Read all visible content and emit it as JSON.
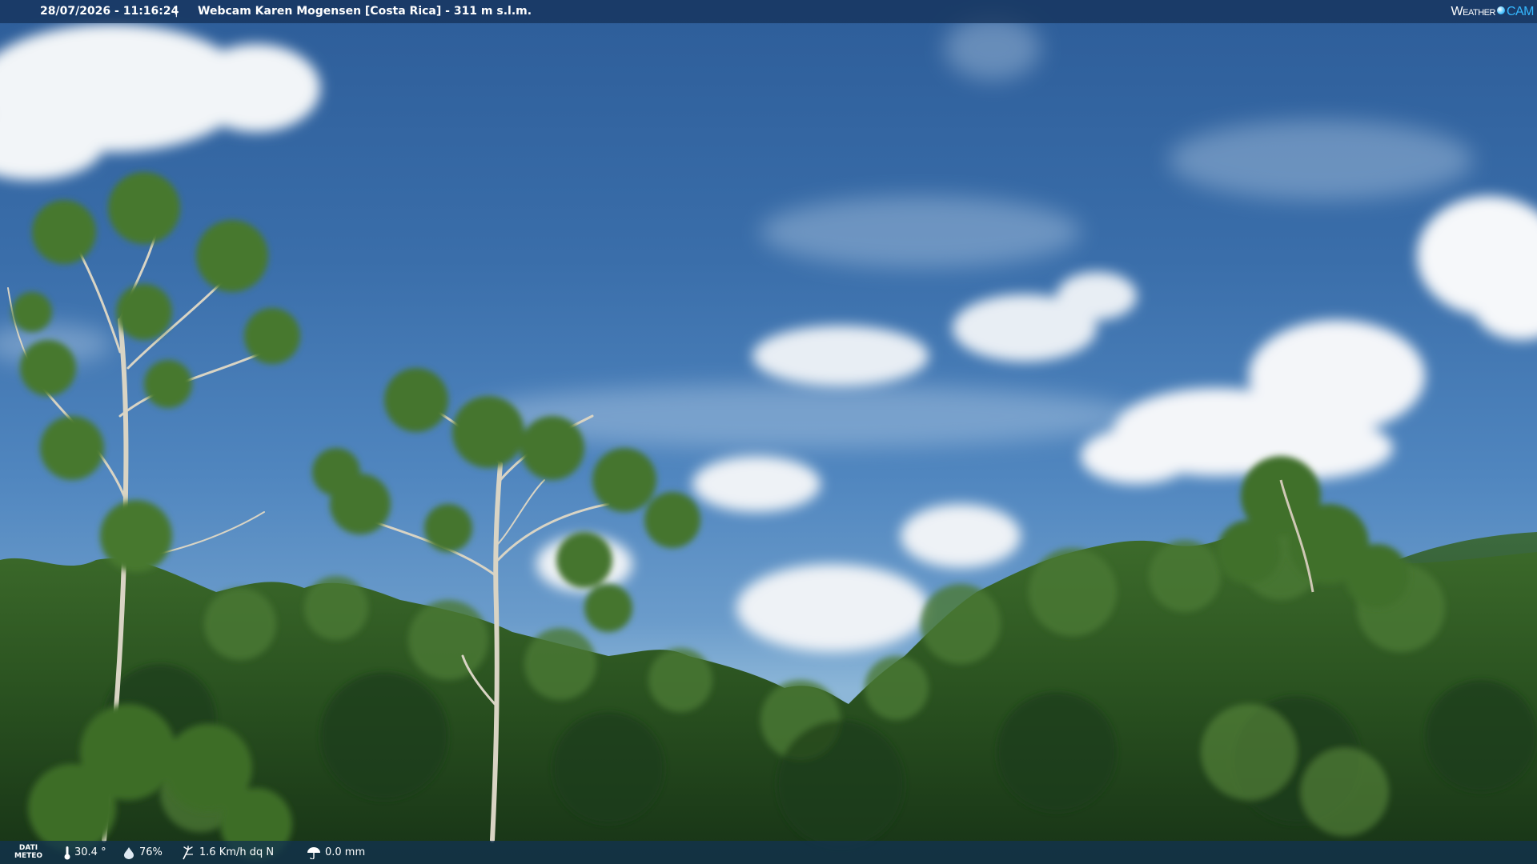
{
  "header": {
    "datetime": "28/07/2026 - 11:16:24",
    "separator": "|",
    "title": "Webcam Karen Mogensen [Costa Rica] - 311 m s.l.m.",
    "logo_word": "Weather",
    "logo_cam": "CAM"
  },
  "weather": {
    "label_line1": "DATI",
    "label_line2": "METEO",
    "temperature": "30.4 °",
    "humidity": "76%",
    "wind": "1.6 Km/h dq N",
    "rain": "0.0 mm"
  },
  "icons": {
    "temperature": "thermometer-icon",
    "humidity": "droplet-icon",
    "wind": "wind-icon",
    "rain": "umbrella-icon"
  },
  "colors": {
    "bar_background": "#14325a",
    "logo_accent": "#35b8ff",
    "sky": "#3a6eaa",
    "foliage": "#2f5a22"
  }
}
